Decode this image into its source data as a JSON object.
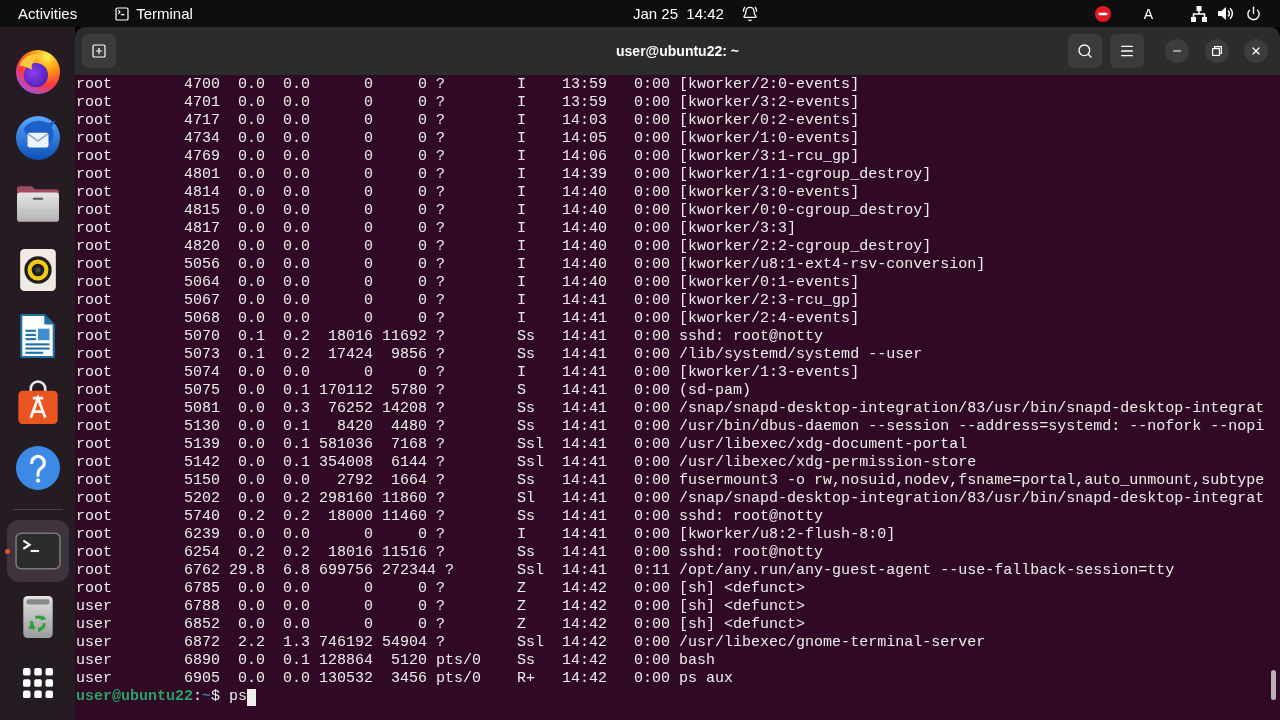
{
  "top_bar": {
    "activities": "Activities",
    "app_menu": "Terminal",
    "clock": "Jan 25  14:42",
    "input_source": "A"
  },
  "dock": {
    "favorites": [
      {
        "running": false,
        "selected": false
      },
      {
        "running": false,
        "selected": false
      },
      {
        "running": false,
        "selected": false
      },
      {
        "running": false,
        "selected": false
      },
      {
        "running": false,
        "selected": false
      },
      {
        "running": false,
        "selected": false
      },
      {
        "running": false,
        "selected": false
      }
    ],
    "others": [
      {
        "running": true,
        "selected": true
      }
    ]
  },
  "window": {
    "title": "user@ubuntu22: ~"
  },
  "terminal": {
    "lines": [
      "root        4700  0.0  0.0      0     0 ?        I    13:59   0:00 [kworker/2:0-events]",
      "root        4701  0.0  0.0      0     0 ?        I    13:59   0:00 [kworker/3:2-events]",
      "root        4717  0.0  0.0      0     0 ?        I    14:03   0:00 [kworker/0:2-events]",
      "root        4734  0.0  0.0      0     0 ?        I    14:05   0:00 [kworker/1:0-events]",
      "root        4769  0.0  0.0      0     0 ?        I    14:06   0:00 [kworker/3:1-rcu_gp]",
      "root        4801  0.0  0.0      0     0 ?        I    14:39   0:00 [kworker/1:1-cgroup_destroy]",
      "root        4814  0.0  0.0      0     0 ?        I    14:40   0:00 [kworker/3:0-events]",
      "root        4815  0.0  0.0      0     0 ?        I    14:40   0:00 [kworker/0:0-cgroup_destroy]",
      "root        4817  0.0  0.0      0     0 ?        I    14:40   0:00 [kworker/3:3]",
      "root        4820  0.0  0.0      0     0 ?        I    14:40   0:00 [kworker/2:2-cgroup_destroy]",
      "root        5056  0.0  0.0      0     0 ?        I    14:40   0:00 [kworker/u8:1-ext4-rsv-conversion]",
      "root        5064  0.0  0.0      0     0 ?        I    14:40   0:00 [kworker/0:1-events]",
      "root        5067  0.0  0.0      0     0 ?        I    14:41   0:00 [kworker/2:3-rcu_gp]",
      "root        5068  0.0  0.0      0     0 ?        I    14:41   0:00 [kworker/2:4-events]",
      "root        5070  0.1  0.2  18016 11692 ?        Ss   14:41   0:00 sshd: root@notty",
      "root        5073  0.1  0.2  17424  9856 ?        Ss   14:41   0:00 /lib/systemd/systemd --user",
      "root        5074  0.0  0.0      0     0 ?        I    14:41   0:00 [kworker/1:3-events]",
      "root        5075  0.0  0.1 170112  5780 ?        S    14:41   0:00 (sd-pam)",
      "root        5081  0.0  0.3  76252 14208 ?        Ss   14:41   0:00 /snap/snapd-desktop-integration/83/usr/bin/snapd-desktop-integrat",
      "root        5130  0.0  0.1   8420  4480 ?        Ss   14:41   0:00 /usr/bin/dbus-daemon --session --address=systemd: --nofork --nopi",
      "root        5139  0.0  0.1 581036  7168 ?        Ssl  14:41   0:00 /usr/libexec/xdg-document-portal",
      "root        5142  0.0  0.1 354008  6144 ?        Ssl  14:41   0:00 /usr/libexec/xdg-permission-store",
      "root        5150  0.0  0.0   2792  1664 ?        Ss   14:41   0:00 fusermount3 -o rw,nosuid,nodev,fsname=portal,auto_unmount,subtype",
      "root        5202  0.0  0.2 298160 11860 ?        Sl   14:41   0:00 /snap/snapd-desktop-integration/83/usr/bin/snapd-desktop-integrat",
      "root        5740  0.2  0.2  18000 11460 ?        Ss   14:41   0:00 sshd: root@notty",
      "root        6239  0.0  0.0      0     0 ?        I    14:41   0:00 [kworker/u8:2-flush-8:0]",
      "root        6254  0.2  0.2  18016 11516 ?        Ss   14:41   0:00 sshd: root@notty",
      "root        6762 29.8  6.8 699756 272344 ?       Ssl  14:41   0:11 /opt/any.run/any-guest-agent --use-fallback-session=tty",
      "root        6785  0.0  0.0      0     0 ?        Z    14:42   0:00 [sh] <defunct>",
      "user        6788  0.0  0.0      0     0 ?        Z    14:42   0:00 [sh] <defunct>",
      "user        6852  0.0  0.0      0     0 ?        Z    14:42   0:00 [sh] <defunct>",
      "user        6872  2.2  1.3 746192 54904 ?        Ssl  14:42   0:00 /usr/libexec/gnome-terminal-server",
      "user        6890  0.0  0.1 128864  5120 pts/0    Ss   14:42   0:00 bash",
      "user        6905  0.0  0.0 130532  3456 pts/0    R+   14:42   0:00 ps aux"
    ],
    "prompt": {
      "user_host": "user@ubuntu22",
      "separator": ":",
      "path": "~",
      "symbol": "$",
      "input": "ps"
    }
  }
}
